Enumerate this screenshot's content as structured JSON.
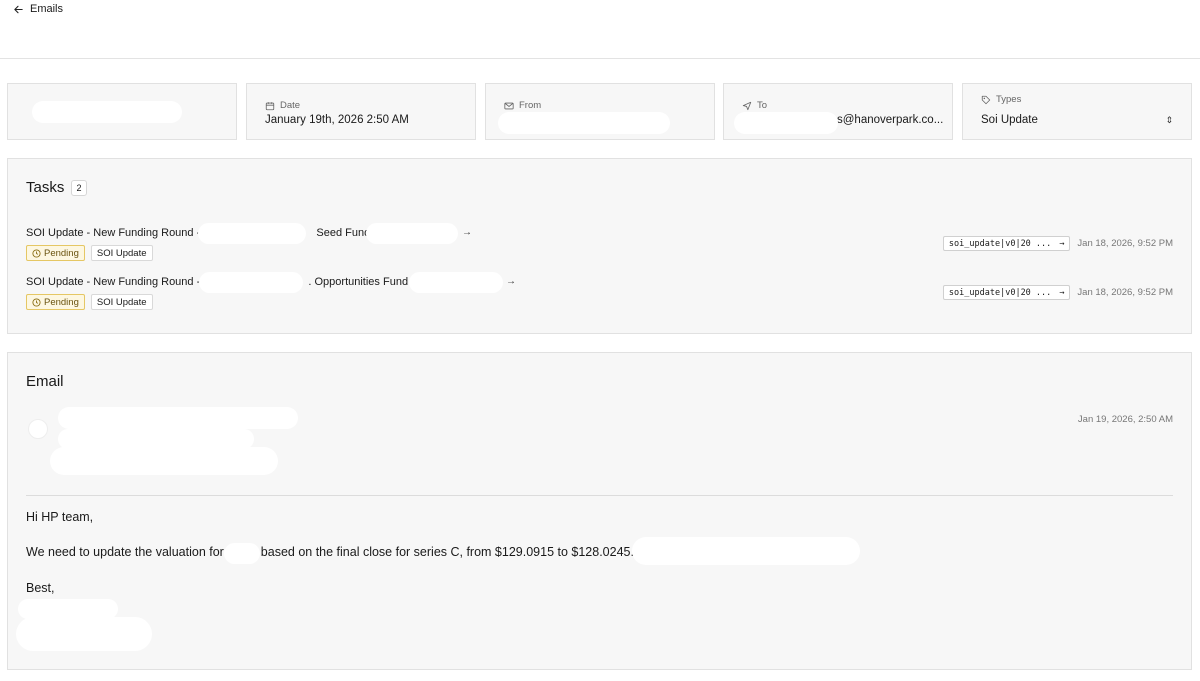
{
  "nav": {
    "back_label": "Emails"
  },
  "meta": {
    "date_label": "Date",
    "date_value": "January 19th, 2026 2:50 AM",
    "from_label": "From",
    "to_label": "To",
    "to_value": "s@hanoverpark.co...",
    "types_label": "Types",
    "types_value": "Soi Update"
  },
  "tasks": {
    "title": "Tasks",
    "count": "2",
    "items": [
      {
        "title_prefix": "SOI Update - New Funding Round -",
        "title_suffix": "Seed Fund",
        "status": "Pending",
        "type": "SOI Update",
        "code": "soi_update|v0|20 ...",
        "date": "Jan 18, 2026, 9:52 PM"
      },
      {
        "title_prefix": "SOI Update - New Funding Round -",
        "title_suffix": ". Opportunities Fund",
        "status": "Pending",
        "type": "SOI Update",
        "code": "soi_update|v0|20 ...",
        "date": "Jan 18, 2026, 9:52 PM"
      }
    ]
  },
  "email": {
    "title": "Email",
    "date": "Jan 19, 2026, 2:50 AM",
    "greeting": "Hi HP team,",
    "body_prefix": "We need to update the valuation for",
    "body_suffix": "based on the final close for series C, from $129.0915 to $128.0245.",
    "signoff": "Best,"
  }
}
